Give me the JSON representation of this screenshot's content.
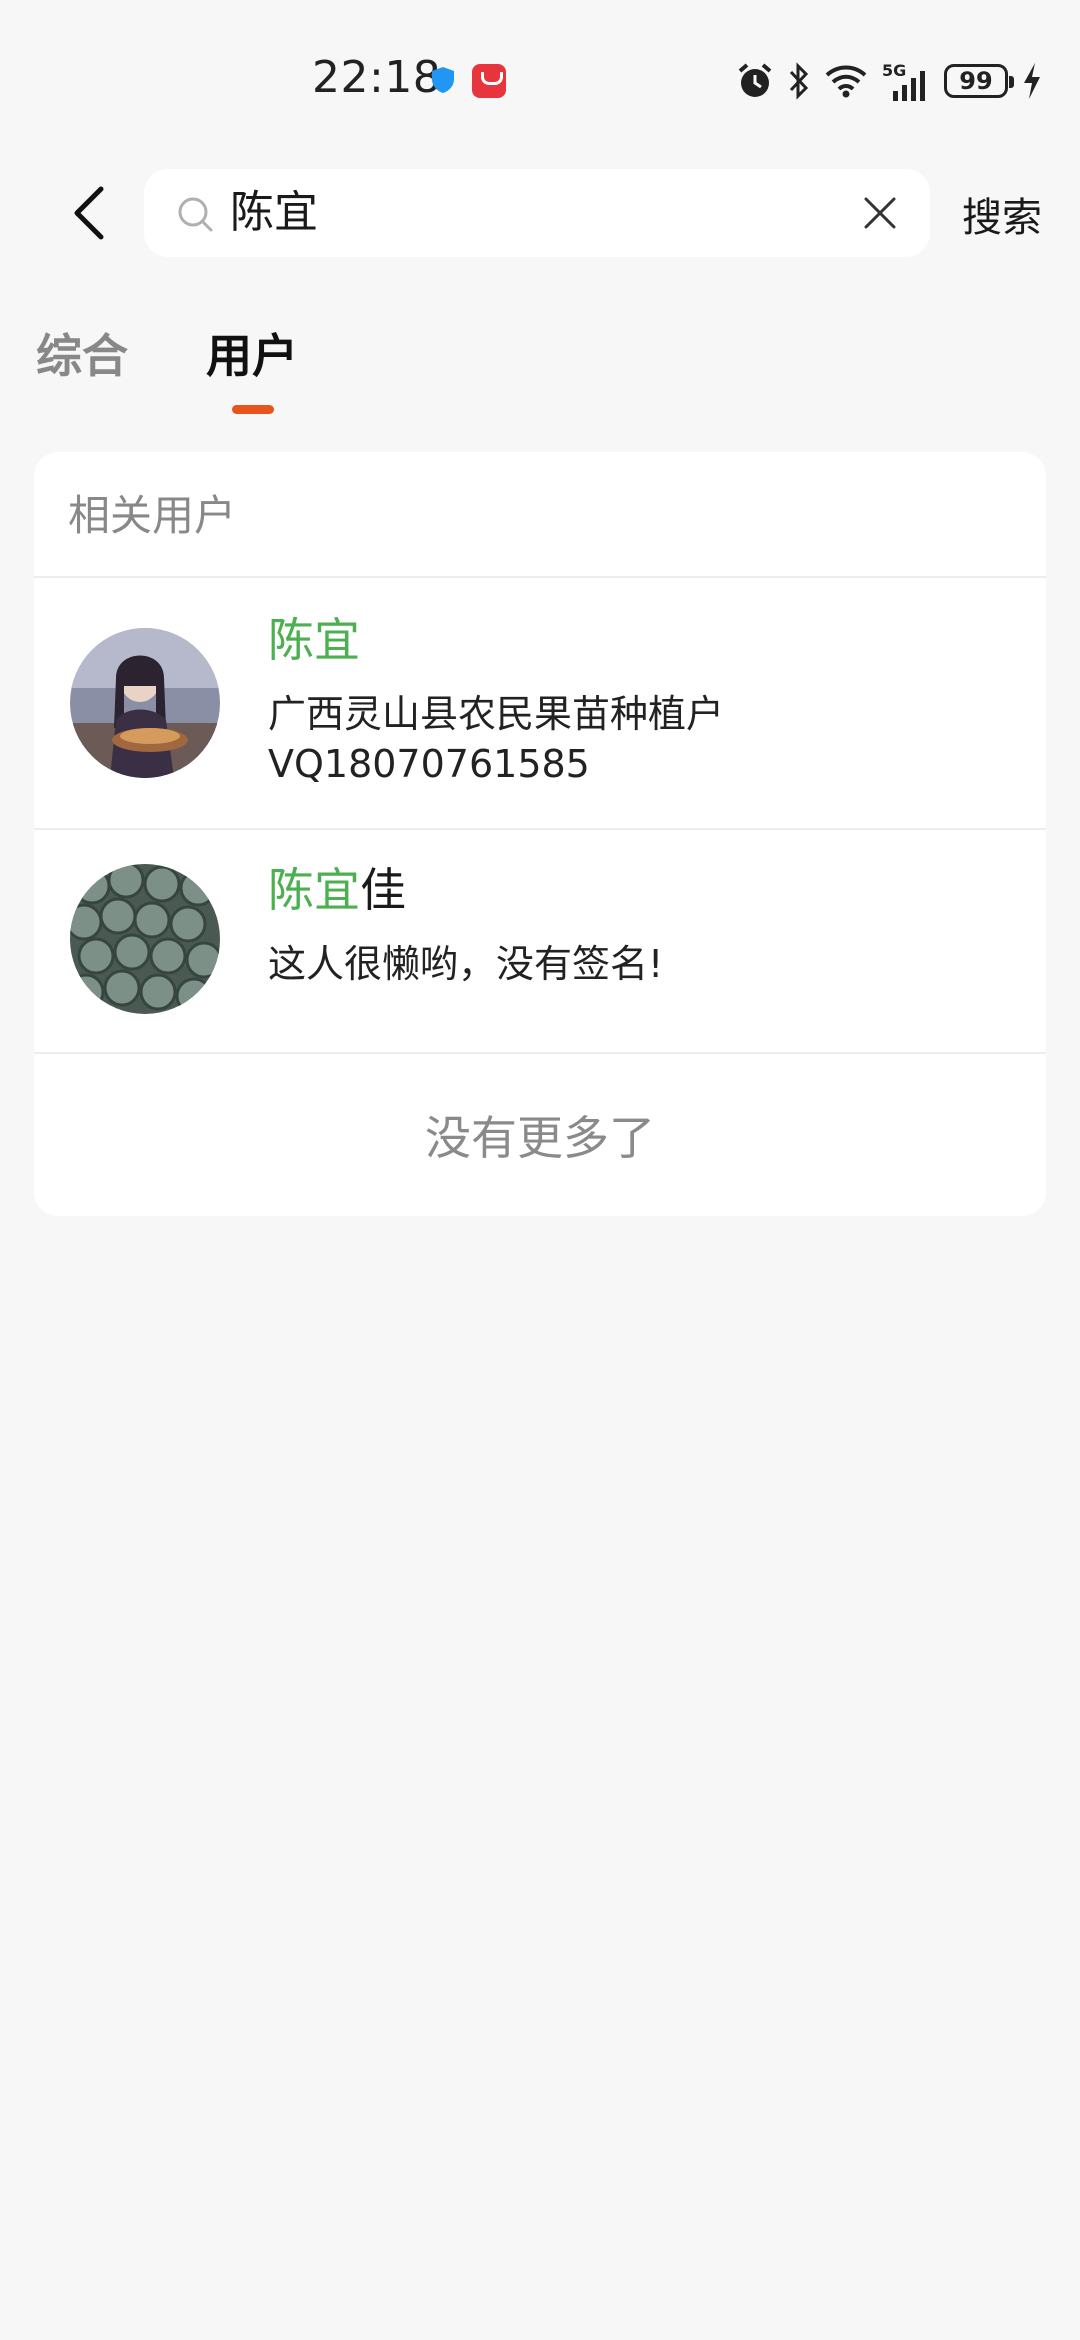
{
  "status_bar": {
    "time": "22:18",
    "network": "5G",
    "battery": "99",
    "icons": [
      "shield-icon",
      "app-icon",
      "alarm-icon",
      "bluetooth-icon",
      "wifi-icon",
      "signal-icon",
      "battery-icon",
      "charging-icon"
    ]
  },
  "header": {
    "search_value": "陈宜",
    "search_button": "搜索"
  },
  "tabs": [
    {
      "label": "综合",
      "active": false
    },
    {
      "label": "用户",
      "active": true
    }
  ],
  "results": {
    "section_title": "相关用户",
    "users": [
      {
        "name_highlight": "陈宜",
        "name_rest": "",
        "desc_line1": "广西灵山县农民果苗种植户",
        "desc_line2": "VQ18070761585"
      },
      {
        "name_highlight": "陈宜",
        "name_rest": "佳",
        "desc_line1": "这人很懒哟，没有签名!",
        "desc_line2": ""
      }
    ],
    "footer": "没有更多了"
  },
  "colors": {
    "accent": "#e8551c",
    "highlight": "#4caf50",
    "background": "#f7f7f7"
  }
}
